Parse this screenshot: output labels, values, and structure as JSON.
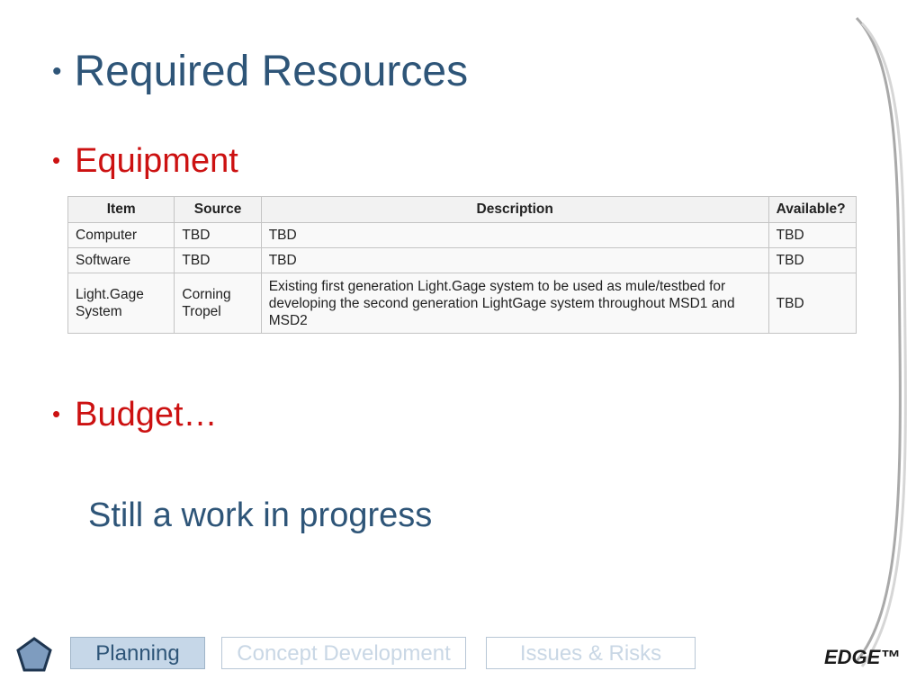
{
  "slide": {
    "title": "Required Resources",
    "bullet": "•"
  },
  "equipment": {
    "heading": "Equipment",
    "table": {
      "headers": [
        "Item",
        "Source",
        "Description",
        "Available?"
      ],
      "rows": [
        [
          "Computer",
          "TBD",
          "TBD",
          "TBD"
        ],
        [
          "Software",
          "TBD",
          "TBD",
          "TBD"
        ],
        [
          "Light.Gage System",
          "Corning Tropel",
          "Existing first generation Light.Gage system to be used as mule/testbed for developing the second generation LightGage system throughout MSD1 and MSD2",
          "TBD"
        ]
      ]
    }
  },
  "budget": {
    "heading": "Budget…",
    "note": "Still a work in progress"
  },
  "nav": {
    "planning": "Planning",
    "concept": "Concept Development",
    "issues": "Issues & Risks"
  },
  "logo": {
    "text": "EDGE™"
  },
  "icons": {
    "home": "pentagon-home-icon"
  },
  "colors": {
    "title": "#2e5578",
    "section": "#cc1111",
    "nav_active_bg": "#c6d7e8",
    "nav_inactive_text": "#c9d7e5"
  }
}
